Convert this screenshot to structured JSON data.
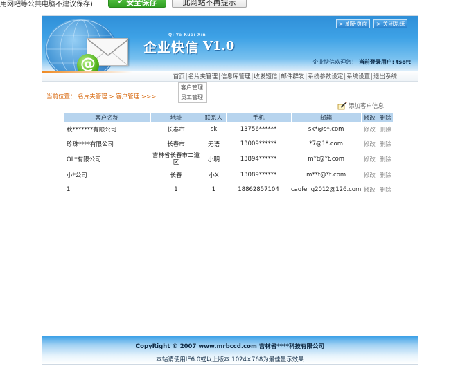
{
  "savebar": {
    "hint": "用网吧等公共电脑不建议保存)",
    "save_label": "安全保存",
    "never_label": "此网站不再提示"
  },
  "header": {
    "pinyin": "Qi Ye Kuai Xin",
    "title": "企业快信",
    "version": "V1.0",
    "refresh_label": "> 刷新页面",
    "close_label": "> 关闭系统",
    "welcome_text": "企业快信欢迎您！",
    "user_prefix": "当前登录用户:",
    "username": "tsoft"
  },
  "nav": {
    "items": [
      "首页",
      "名片夹管理",
      "信息库管理",
      "收发短信",
      "邮件群发",
      "系统参数设定",
      "系统设置",
      "退出系统"
    ],
    "separator": "|",
    "dropdown": [
      "客户管理",
      "员工管理"
    ]
  },
  "breadcrumb": {
    "prefix": "当前位置：",
    "level1": "名片夹管理",
    "arrow1": ">",
    "level2": "客户管理",
    "tail": ">>>"
  },
  "actions": {
    "add_label": "添加客户信息",
    "add_icon": "pencil-note-icon"
  },
  "table": {
    "columns": [
      "客户名称",
      "地址",
      "联系人",
      "手机",
      "邮箱",
      "修改",
      "删除"
    ],
    "rows": [
      [
        "秋*******有限公司",
        "长春市",
        "sk",
        "13756******",
        "sk*@s*.com",
        "修改",
        "删除"
      ],
      [
        "珍珠****有限公司",
        "长春市",
        "无语",
        "13009******",
        "*7@1*.com",
        "修改",
        "删除"
      ],
      [
        "OL*有限公司",
        "吉林省长春市二道区",
        "小明",
        "13894******",
        "m*t@*t.com",
        "修改",
        "删除"
      ],
      [
        "小*公司",
        "长春",
        "小X",
        "13089******",
        "m**t@*t.com",
        "修改",
        "删除"
      ],
      [
        "1",
        "1",
        "1",
        "18862857104",
        "caofeng2012@126.com",
        "修改",
        "删除"
      ]
    ]
  },
  "footer": {
    "copyright": "CopyRight © 2007 www.mrbccd.com 吉林省****科技有限公司",
    "note": "本站请使用IE6.0或以上版本 1024×768为最佳显示效果"
  },
  "colors": {
    "header_blue": "#2f8fd8",
    "table_header": "#b7d4ee",
    "breadcrumb_orange": "#d86a10",
    "save_green": "#2f9e22"
  }
}
